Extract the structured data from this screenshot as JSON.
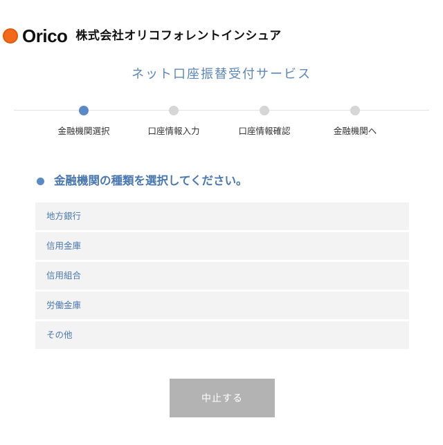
{
  "header": {
    "brand": "Orico",
    "company_name": "株式会社オリコフォレントインシュア",
    "brand_color": "#f26a1b"
  },
  "page": {
    "title": "ネット口座振替受付サービス"
  },
  "stepper": {
    "active_index": 0,
    "active_color": "#5a8ac6",
    "inactive_color": "#d6d6d6",
    "steps": [
      {
        "label": "金融機関選択",
        "active": true
      },
      {
        "label": "口座情報入力",
        "active": false
      },
      {
        "label": "口座情報確認",
        "active": false
      },
      {
        "label": "金融機関へ",
        "active": false
      }
    ]
  },
  "section": {
    "heading": "金融機関の種類を選択してください。"
  },
  "options": [
    {
      "label": "地方銀行"
    },
    {
      "label": "信用金庫"
    },
    {
      "label": "信用組合"
    },
    {
      "label": "労働金庫"
    },
    {
      "label": "その他"
    }
  ],
  "actions": {
    "cancel_label": "中止する"
  }
}
